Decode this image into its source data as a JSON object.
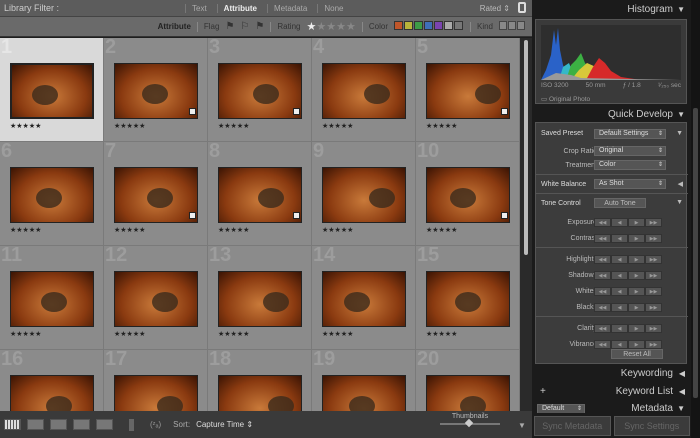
{
  "filter": {
    "title": "Library Filter :",
    "tabs": [
      "Text",
      "Attribute",
      "Metadata",
      "None"
    ],
    "active": "Attribute",
    "rated": "Rated ⇕"
  },
  "attr": {
    "label": "Attribute",
    "flag": "Flag",
    "rating": "Rating",
    "color": "Color",
    "kind": "Kind",
    "swatches": [
      "#c0562a",
      "#b8b43a",
      "#3e9b46",
      "#3f6fb8",
      "#7a44b0",
      "#aaaaaa",
      "#777777"
    ]
  },
  "grid": {
    "cells": [
      {
        "n": "1",
        "stars": "★★★★★",
        "badge": false
      },
      {
        "n": "2",
        "stars": "★★★★★",
        "badge": true
      },
      {
        "n": "3",
        "stars": "★★★★★",
        "badge": true
      },
      {
        "n": "4",
        "stars": "★★★★★",
        "badge": false
      },
      {
        "n": "5",
        "stars": "★★★★★",
        "badge": true
      },
      {
        "n": "6",
        "stars": "★★★★★",
        "badge": false
      },
      {
        "n": "7",
        "stars": "★★★★★",
        "badge": true
      },
      {
        "n": "8",
        "stars": "★★★★★",
        "badge": true
      },
      {
        "n": "9",
        "stars": "★★★★★",
        "badge": false
      },
      {
        "n": "10",
        "stars": "★★★★★",
        "badge": true
      },
      {
        "n": "11",
        "stars": "★★★★★",
        "badge": false
      },
      {
        "n": "12",
        "stars": "★★★★★",
        "badge": false
      },
      {
        "n": "13",
        "stars": "★★★★★",
        "badge": false
      },
      {
        "n": "14",
        "stars": "★★★★★",
        "badge": false
      },
      {
        "n": "15",
        "stars": "★★★★★",
        "badge": false
      },
      {
        "n": "16",
        "stars": "",
        "badge": false
      },
      {
        "n": "17",
        "stars": "",
        "badge": false
      },
      {
        "n": "18",
        "stars": "",
        "badge": false
      },
      {
        "n": "19",
        "stars": "",
        "badge": false
      },
      {
        "n": "20",
        "stars": "",
        "badge": false
      }
    ]
  },
  "toolbar": {
    "sort_label": "Sort:",
    "sort_value": "Capture Time ⇕",
    "thumbnails": "Thumbnails"
  },
  "panel": {
    "histogram": "Histogram",
    "iso": "ISO 3200",
    "focal": "50 mm",
    "aperture": "ƒ / 1.8",
    "shutter": "¹⁄₂₅₀ sec",
    "original": "Original Photo",
    "quick_develop": "Quick Develop",
    "saved_preset": "Saved Preset",
    "saved_preset_value": "Default Settings",
    "crop_ratio": "Crop Ratio",
    "crop_ratio_value": "Original",
    "treatment": "Treatment",
    "treatment_value": "Color",
    "white_balance": "White Balance",
    "white_balance_value": "As Shot",
    "tone_control": "Tone Control",
    "auto_tone": "Auto Tone",
    "sliders": [
      "Exposure",
      "Contrast",
      "Highlights",
      "Shadows",
      "Whites",
      "Blacks",
      "Clarity",
      "Vibrance"
    ],
    "reset_all": "Reset All",
    "keywording": "Keywording",
    "keyword_list": "Keyword List",
    "metadata": "Metadata",
    "metadata_preset": "Default",
    "sync_metadata": "Sync Metadata",
    "sync_settings": "Sync Settings"
  }
}
